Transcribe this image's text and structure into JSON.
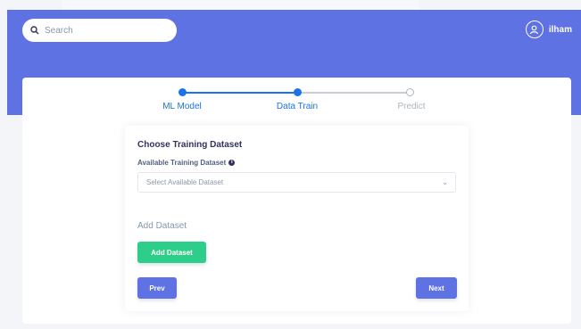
{
  "header": {
    "search_placeholder": "Search",
    "user_name": "ilham"
  },
  "stepper": {
    "steps": [
      {
        "label": "ML Model",
        "state": "done"
      },
      {
        "label": "Data Train",
        "state": "current"
      },
      {
        "label": "Predict",
        "state": "todo"
      }
    ]
  },
  "form": {
    "title": "Choose Training Dataset",
    "field_label": "Available Training Dataset",
    "select_placeholder": "Select Available Dataset",
    "add_label": "Add Dataset",
    "add_button": "Add Dataset",
    "prev_button": "Prev",
    "next_button": "Next"
  },
  "colors": {
    "header_bg": "#5e72e4",
    "step_active": "#1a73e8",
    "add_button": "#2dce89",
    "nav_button": "#5e72e4"
  }
}
